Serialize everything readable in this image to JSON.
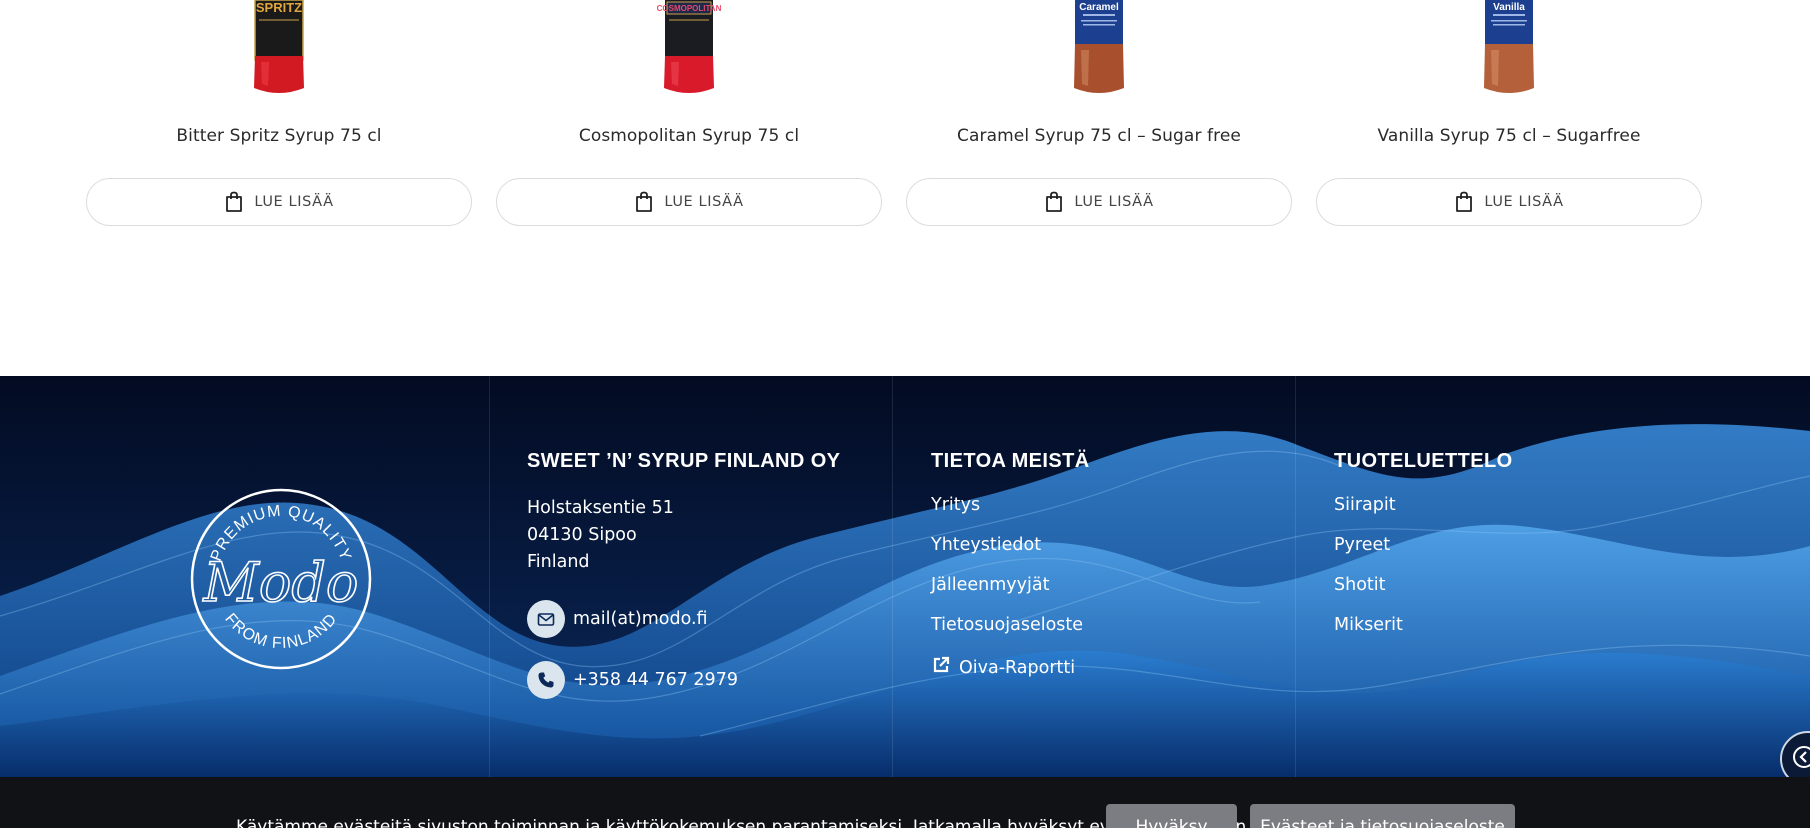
{
  "products": [
    {
      "name": "Bitter Spritz Syrup 75 cl",
      "button": "LUE LISÄÄ",
      "bottle_color": "#d21a22",
      "label_color": "#1a1a1a",
      "label_text": "SPRITZ"
    },
    {
      "name": "Cosmopolitan Syrup 75 cl",
      "button": "LUE LISÄÄ",
      "bottle_color": "#d81a2a",
      "label_color": "#1b1b22",
      "label_text": "COSMOPOLITAN"
    },
    {
      "name": "Caramel Syrup 75 cl – Sugar free",
      "button": "LUE LISÄÄ",
      "bottle_color": "#a8502d",
      "label_color": "#1c3f8f",
      "label_text": "Caramel"
    },
    {
      "name": "Vanilla Syrup 75 cl – Sugarfree",
      "button": "LUE LISÄÄ",
      "bottle_color": "#b4603a",
      "label_color": "#1c3f8f",
      "label_text": "Vanilla"
    }
  ],
  "footer": {
    "badge": {
      "top_text": "PREMIUM QUALITY",
      "logo": "Modo",
      "bottom_text": "FROM FINLAND"
    },
    "company": {
      "heading": "SWEET ’N’ SYRUP FINLAND OY",
      "address": [
        "Holstaksentie 51",
        "04130 Sipoo",
        "Finland"
      ],
      "email": "mail(at)modo.fi",
      "phone": "+358 44 767 2979"
    },
    "about": {
      "heading": "TIETOA MEISTÄ",
      "links": [
        "Yritys",
        "Yhteystiedot",
        "Jälleenmyyjät",
        "Tietosuojaseloste"
      ],
      "external_link": "Oiva-Raportti"
    },
    "catalog": {
      "heading": "TUOTELUETTELO",
      "links": [
        "Siirapit",
        "Pyreet",
        "Shotit",
        "Mikserit"
      ]
    },
    "colors": {
      "background": "#04102e",
      "wave": "#1a6fc4",
      "icon_circle": "#dbe5ee"
    }
  },
  "cookie_bar": {
    "text": "Käytämme evästeitä sivuston toiminnan ja käyttökokemuksen parantamiseksi. Jatkamalla hyväksyt evästeiden käytön.",
    "accept_button": "Hyväksy",
    "info_button": "Evästeet ja tietosuojaseloste"
  },
  "icons": {
    "shopping_bag": "bag-icon",
    "mail": "envelope-icon",
    "phone": "phone-icon",
    "external": "external-link-icon",
    "float": "accessibility-icon"
  }
}
